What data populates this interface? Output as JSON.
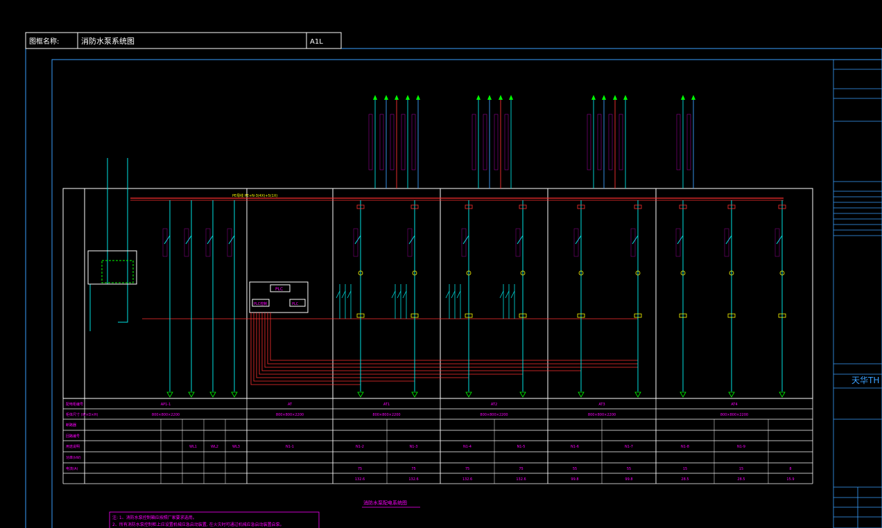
{
  "header": {
    "label": "图框名称:",
    "title": "消防水泵系统图",
    "sheet": "A1L"
  },
  "titleblock": {
    "brand": "天华TH"
  },
  "diagram": {
    "busbar_label": "PE母线 PE+N-3(4X)+5(1X)",
    "plc_box": [
      "PLC",
      "PLC控制",
      "PLC"
    ],
    "cubicles": [
      {
        "name": "AP1-1"
      },
      {
        "name": "AT"
      },
      {
        "name": "AT1"
      },
      {
        "name": "AT2"
      },
      {
        "name": "AT3"
      },
      {
        "name": "AT4"
      }
    ],
    "table_rows": [
      "配电柜编号",
      "柜体尺寸 (W×D×H)",
      "断路器",
      "回路编号",
      "用途说明",
      "功率(kW)",
      "电流(A)"
    ],
    "table_values": {
      "row0": [
        "AP1-1",
        "AT",
        "AT1",
        "AT2",
        "AT3",
        "AT4"
      ],
      "row1": [
        "800×800×2200",
        "800×800×2200",
        "800×800×2200",
        "800×800×2200",
        "800×800×2200",
        "800×800×2200"
      ],
      "row3": [
        "WL1",
        "WL2",
        "WL3",
        "N1-1",
        "N1-2",
        "N1-3",
        "N1-4",
        "N1-5",
        "N1-6",
        "N1-7",
        "N1-8",
        "N1-9"
      ],
      "row5": [
        "75",
        "75",
        "75",
        "75",
        "55",
        "55",
        "15",
        "15",
        "8"
      ],
      "row6": [
        "132.6",
        "132.6",
        "132.6",
        "132.6",
        "99.8",
        "99.8",
        "28.5",
        "28.5",
        "15.9"
      ]
    },
    "diagram_title": "消防水泵配电系统图",
    "notes": [
      "注: 1、消防水泵控制箱应按照厂家要求选用。",
      "2、所有消防水泵控制柜上应设置机械应急启动装置, 在火灾时可通过机械应急启动装置启泵。"
    ]
  }
}
